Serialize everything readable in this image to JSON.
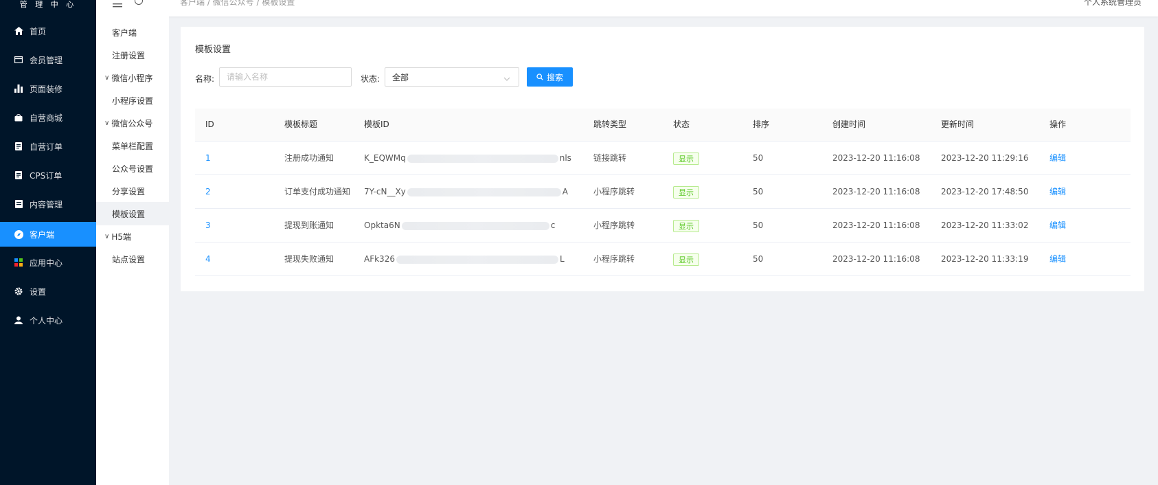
{
  "brand": "管 理 中 心",
  "sidebar": {
    "items": [
      {
        "label": "首页",
        "icon": "home-icon"
      },
      {
        "label": "会员管理",
        "icon": "card-icon"
      },
      {
        "label": "页面装修",
        "icon": "bar-chart-icon"
      },
      {
        "label": "自营商城",
        "icon": "shopping-bag-icon"
      },
      {
        "label": "自营订单",
        "icon": "document-icon"
      },
      {
        "label": "CPS订单",
        "icon": "document-icon"
      },
      {
        "label": "内容管理",
        "icon": "list-box-icon"
      },
      {
        "label": "客户端",
        "icon": "compass-icon",
        "active": true
      },
      {
        "label": "应用中心",
        "icon": "apps-icon"
      },
      {
        "label": "设置",
        "icon": "gear-icon"
      },
      {
        "label": "个人中心",
        "icon": "user-icon"
      }
    ]
  },
  "header": {
    "breadcrumb": "客户端 / 微信公众号 / 模板设置",
    "user": "个人系统管理员"
  },
  "submenu": {
    "items": [
      {
        "label": "客户端",
        "type": "item"
      },
      {
        "label": "注册设置",
        "type": "item"
      },
      {
        "label": "微信小程序",
        "type": "group"
      },
      {
        "label": "小程序设置",
        "type": "item"
      },
      {
        "label": "微信公众号",
        "type": "group"
      },
      {
        "label": "菜单栏配置",
        "type": "item"
      },
      {
        "label": "公众号设置",
        "type": "item"
      },
      {
        "label": "分享设置",
        "type": "item"
      },
      {
        "label": "模板设置",
        "type": "item",
        "active": true
      },
      {
        "label": "H5端",
        "type": "group"
      },
      {
        "label": "站点设置",
        "type": "item"
      }
    ]
  },
  "page": {
    "title": "模板设置",
    "filters": {
      "name_label": "名称:",
      "name_placeholder": "请输入名称",
      "status_label": "状态:",
      "status_value": "全部",
      "search_label": "搜索"
    }
  },
  "table": {
    "columns": [
      "ID",
      "模板标题",
      "模板ID",
      "跳转类型",
      "状态",
      "排序",
      "创建时间",
      "更新时间",
      "操作"
    ],
    "rows": [
      {
        "id": "1",
        "title": "注册成功通知",
        "tpl_prefix": "K_EQWMq",
        "tpl_suffix": "nls",
        "jump": "链接跳转",
        "status": "显示",
        "sort": "50",
        "created": "2023-12-20 11:16:08",
        "updated": "2023-12-20 11:29:16",
        "action": "编辑"
      },
      {
        "id": "2",
        "title": "订单支付成功通知",
        "tpl_prefix": "7Y-cN__Xy",
        "tpl_suffix": "A",
        "jump": "小程序跳转",
        "status": "显示",
        "sort": "50",
        "created": "2023-12-20 11:16:08",
        "updated": "2023-12-20 17:48:50",
        "action": "编辑"
      },
      {
        "id": "3",
        "title": "提现到账通知",
        "tpl_prefix": "Opkta6N",
        "tpl_suffix": "c",
        "jump": "小程序跳转",
        "status": "显示",
        "sort": "50",
        "created": "2023-12-20 11:16:08",
        "updated": "2023-12-20 11:33:02",
        "action": "编辑"
      },
      {
        "id": "4",
        "title": "提现失败通知",
        "tpl_prefix": "AFk326",
        "tpl_suffix": "L",
        "jump": "小程序跳转",
        "status": "显示",
        "sort": "50",
        "created": "2023-12-20 11:16:08",
        "updated": "2023-12-20 11:33:19",
        "action": "编辑"
      }
    ]
  },
  "colors": {
    "sidebar_bg": "#001529",
    "accent": "#1890ff",
    "tag_green": "#52c41a"
  }
}
